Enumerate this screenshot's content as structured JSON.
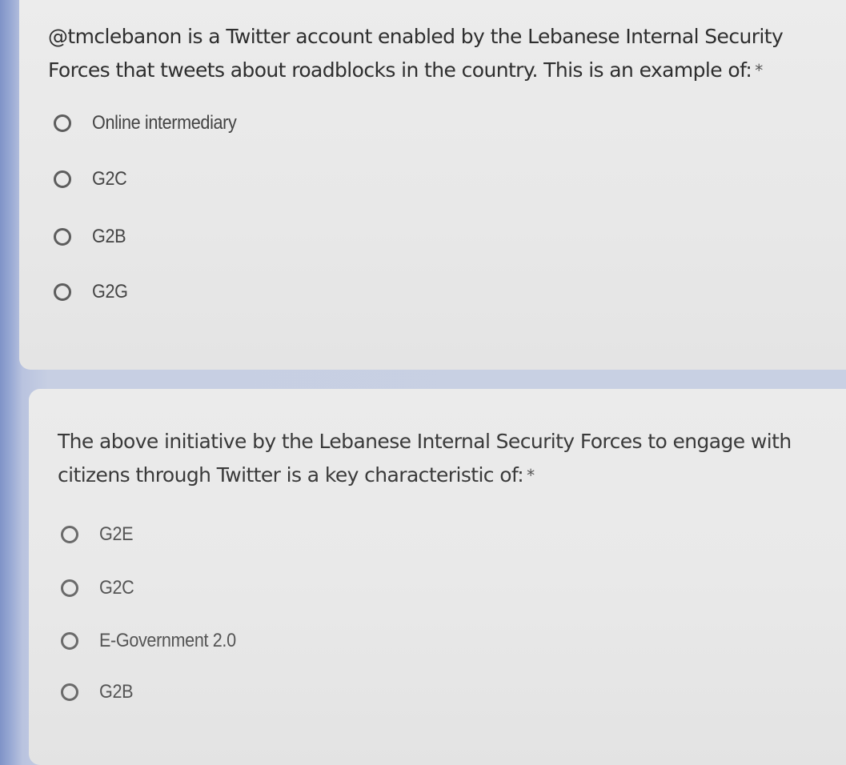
{
  "questions": [
    {
      "text": "@tmclebanon is a Twitter account enabled by the Lebanese Internal Security Forces that tweets about roadblocks in the country. This is an example of:",
      "required_mark": "*",
      "options": [
        "Online intermediary",
        "G2C",
        "G2B",
        "G2G"
      ]
    },
    {
      "text": "The above initiative by the Lebanese Internal Security Forces to engage with citizens through Twitter is a key characteristic of:",
      "required_mark": "*",
      "options": [
        "G2E",
        "G2C",
        "E-Government 2.0",
        "G2B"
      ]
    }
  ],
  "colors": {
    "card_background": "#ebebeb",
    "page_background": "#c8d0e3",
    "left_accent": "#7f93c7",
    "text": "#2e2e2e",
    "radio_outline": "#5d5d5d"
  },
  "icons": {
    "radio": "radio-unselected-icon"
  }
}
